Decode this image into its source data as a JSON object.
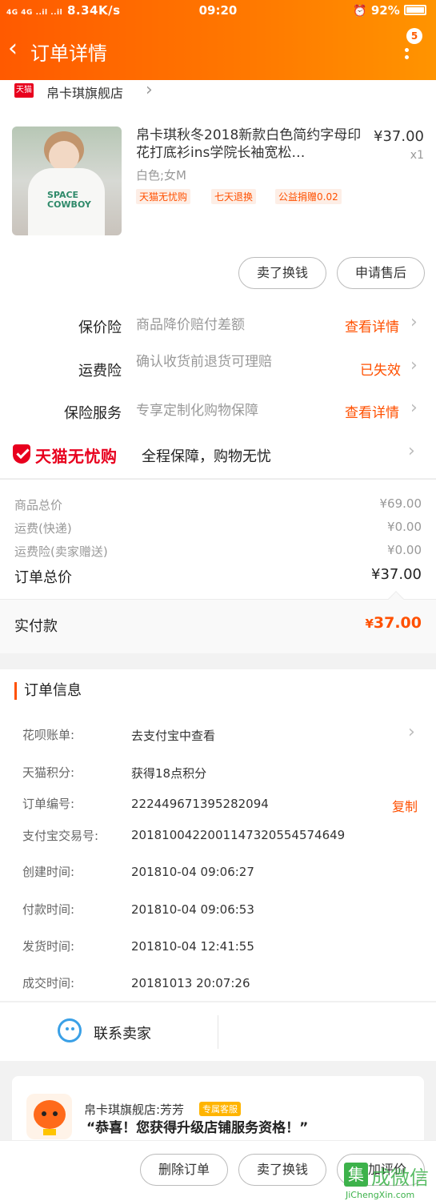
{
  "status_bar": {
    "signal": "4G 4G ..il ..il",
    "speed": "8.34K/s",
    "time": "09:20",
    "battery": "92%"
  },
  "header": {
    "title": "订单详情",
    "badge": "5"
  },
  "store": {
    "tag": "天猫",
    "name": "帛卡琪旗舰店"
  },
  "product": {
    "title": "帛卡琪秋冬2018新款白色简约字母印花打底衫ins学院长袖宽松…",
    "price": "¥37.00",
    "qty": "x1",
    "spec": "白色;女M",
    "tags": [
      "天猫无忧购",
      "七天退换",
      "公益捐赠0.02"
    ],
    "image_text": [
      "SPACE",
      "COWBOY"
    ]
  },
  "actions": {
    "sell_button": "卖了换钱",
    "aftersale_button": "申请售后"
  },
  "services": [
    {
      "label": "保价险",
      "desc": "商品降价赔付差额",
      "link": "查看详情"
    },
    {
      "label": "运费险",
      "desc": "确认收货前退货可理赔",
      "link": "已失效"
    },
    {
      "label": "保险服务",
      "desc": "专享定制化购物保障",
      "link": "查看详情"
    }
  ],
  "tmall_promo": {
    "logo_text": "天猫无忧购",
    "slogan": "全程保障，购物无忧"
  },
  "price_summary": {
    "goods_label": "商品总价",
    "goods_value": "¥69.00",
    "shipping_label": "运费(快递)",
    "shipping_value": "¥0.00",
    "insurance_label": "运费险(卖家赠送)",
    "insurance_value": "¥0.00",
    "total_label": "订单总价",
    "total_value": "¥37.00",
    "paid_label": "实付款",
    "paid_currency": "¥",
    "paid_value": "37.00"
  },
  "order_info": {
    "heading": "订单信息",
    "rows": [
      {
        "key": "花呗账单:",
        "value": "去支付宝中查看"
      },
      {
        "key": "天猫积分:",
        "value": "获得18点积分"
      },
      {
        "key": "订单编号:",
        "value": "222449671395282094"
      },
      {
        "key": "支付宝交易号:",
        "value": "2018100422001147320554574649"
      },
      {
        "key": "创建时间:",
        "value": "201810-04 09:06:27"
      },
      {
        "key": "付款时间:",
        "value": "201810-04 09:06:53"
      },
      {
        "key": "发货时间:",
        "value": "201810-04 12:41:55"
      },
      {
        "key": "成交时间:",
        "value": "20181013 20:07:26"
      }
    ],
    "copy_label": "复制"
  },
  "contact": {
    "label": "联系卖家"
  },
  "message": {
    "sender": "帛卡琪旗舰店:芳芳",
    "badge": "专属客服",
    "text": "“恭喜！您获得升级店铺服务资格！”"
  },
  "bottom_bar": {
    "delete_button": "删除订单",
    "sell_button": "卖了换钱",
    "review_button": "追加评价"
  },
  "watermark": {
    "char": "集",
    "title": "成微信",
    "url": "JiChengXin.com"
  },
  "colors": {
    "accent": "#ff5000",
    "tmall_red": "#e8001e",
    "header_gradient_start": "#ff5a00",
    "header_gradient_end": "#ff9400"
  }
}
